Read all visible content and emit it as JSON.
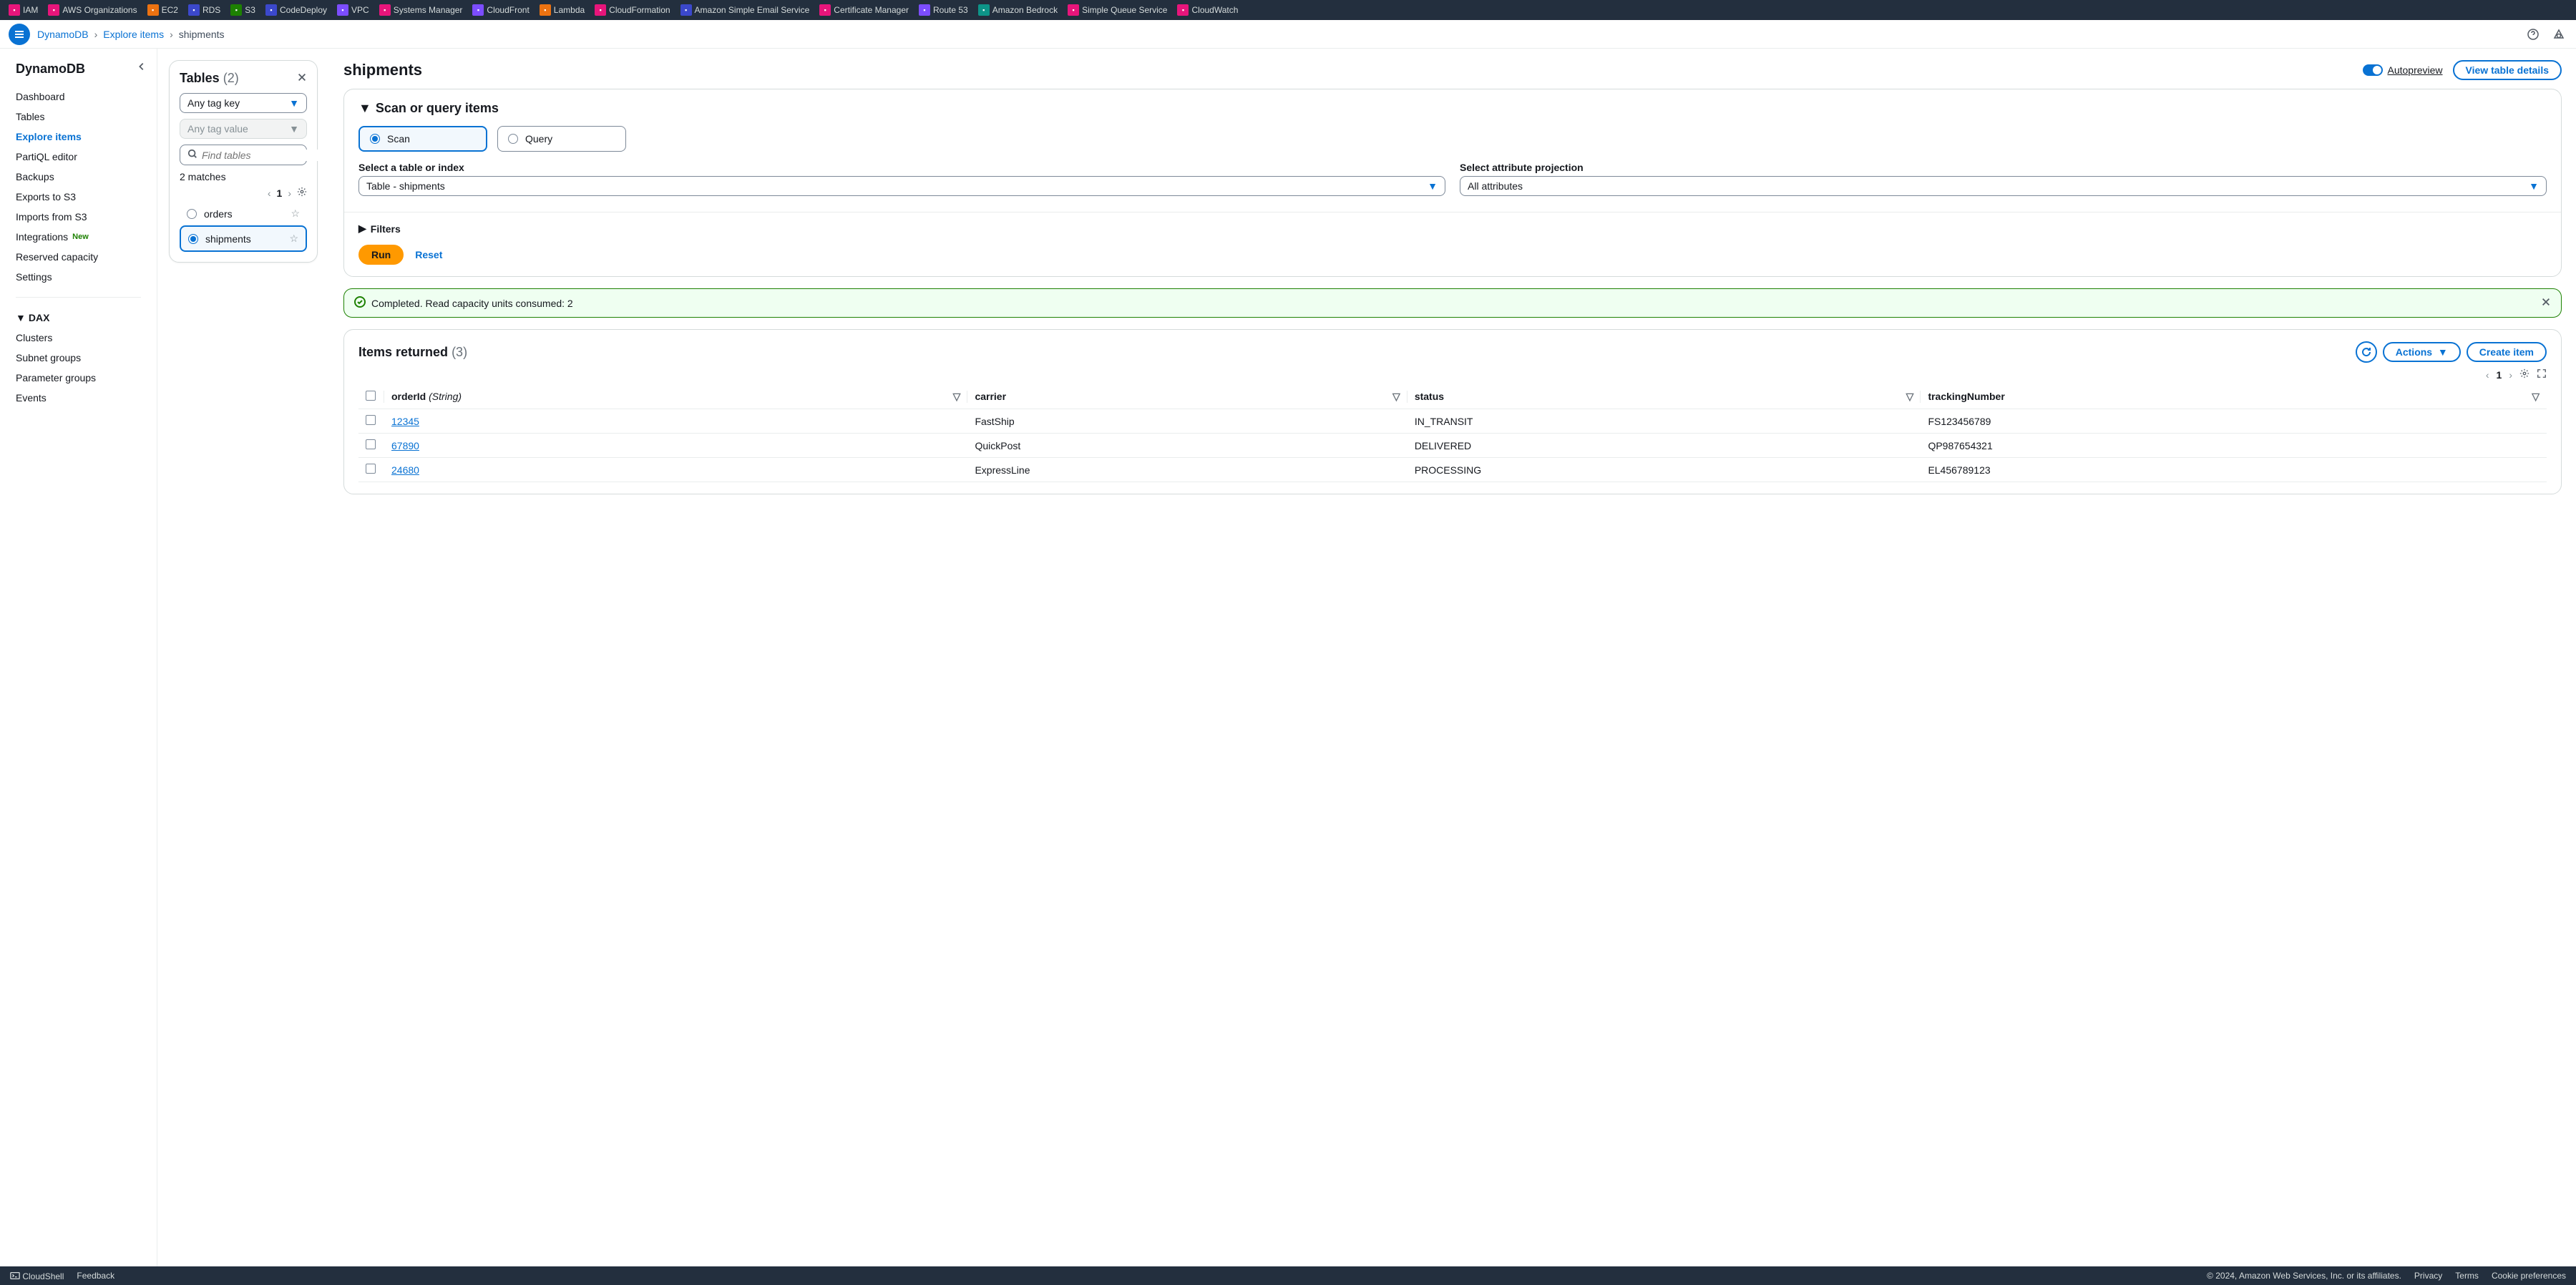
{
  "services": [
    {
      "label": "IAM",
      "bg": "#e7157b"
    },
    {
      "label": "AWS Organizations",
      "bg": "#e7157b"
    },
    {
      "label": "EC2",
      "bg": "#ec7211"
    },
    {
      "label": "RDS",
      "bg": "#3b48cc"
    },
    {
      "label": "S3",
      "bg": "#1d8102"
    },
    {
      "label": "CodeDeploy",
      "bg": "#3b48cc"
    },
    {
      "label": "VPC",
      "bg": "#7c4dff"
    },
    {
      "label": "Systems Manager",
      "bg": "#e7157b"
    },
    {
      "label": "CloudFront",
      "bg": "#7c4dff"
    },
    {
      "label": "Lambda",
      "bg": "#ec7211"
    },
    {
      "label": "CloudFormation",
      "bg": "#e7157b"
    },
    {
      "label": "Amazon Simple Email Service",
      "bg": "#3b48cc"
    },
    {
      "label": "Certificate Manager",
      "bg": "#e7157b"
    },
    {
      "label": "Route 53",
      "bg": "#7c4dff"
    },
    {
      "label": "Amazon Bedrock",
      "bg": "#0d9488"
    },
    {
      "label": "Simple Queue Service",
      "bg": "#e7157b"
    },
    {
      "label": "CloudWatch",
      "bg": "#e7157b"
    }
  ],
  "breadcrumb": {
    "root": "DynamoDB",
    "mid": "Explore items",
    "current": "shipments"
  },
  "sidebar": {
    "title": "DynamoDB",
    "items": [
      {
        "label": "Dashboard"
      },
      {
        "label": "Tables"
      },
      {
        "label": "Explore items",
        "active": true
      },
      {
        "label": "PartiQL editor"
      },
      {
        "label": "Backups"
      },
      {
        "label": "Exports to S3"
      },
      {
        "label": "Imports from S3"
      },
      {
        "label": "Integrations",
        "badge": "New"
      },
      {
        "label": "Reserved capacity"
      },
      {
        "label": "Settings"
      }
    ],
    "dax": {
      "title": "DAX",
      "items": [
        "Clusters",
        "Subnet groups",
        "Parameter groups",
        "Events"
      ]
    }
  },
  "tablesPanel": {
    "title": "Tables",
    "count": "(2)",
    "tagKey": "Any tag key",
    "tagValue": "Any tag value",
    "searchPlaceholder": "Find tables",
    "matches": "2 matches",
    "page": "1",
    "rows": [
      {
        "name": "orders",
        "selected": false
      },
      {
        "name": "shipments",
        "selected": true
      }
    ]
  },
  "main": {
    "title": "shipments",
    "autopreview": "Autopreview",
    "viewDetails": "View table details",
    "scanQuery": {
      "title": "Scan or query items",
      "scan": "Scan",
      "query": "Query",
      "tableLabel": "Select a table or index",
      "tableValue": "Table - shipments",
      "projLabel": "Select attribute projection",
      "projValue": "All attributes",
      "filters": "Filters",
      "run": "Run",
      "reset": "Reset"
    },
    "flash": "Completed. Read capacity units consumed: 2",
    "items": {
      "title": "Items returned",
      "count": "(3)",
      "actions": "Actions",
      "create": "Create item",
      "page": "1",
      "columns": [
        {
          "label": "orderId",
          "type": "(String)"
        },
        {
          "label": "carrier"
        },
        {
          "label": "status"
        },
        {
          "label": "trackingNumber"
        }
      ],
      "rows": [
        {
          "orderId": "12345",
          "carrier": "FastShip",
          "status": "IN_TRANSIT",
          "trackingNumber": "FS123456789"
        },
        {
          "orderId": "67890",
          "carrier": "QuickPost",
          "status": "DELIVERED",
          "trackingNumber": "QP987654321"
        },
        {
          "orderId": "24680",
          "carrier": "ExpressLine",
          "status": "PROCESSING",
          "trackingNumber": "EL456789123"
        }
      ]
    }
  },
  "footer": {
    "cloudshell": "CloudShell",
    "feedback": "Feedback",
    "copyright": "© 2024, Amazon Web Services, Inc. or its affiliates.",
    "privacy": "Privacy",
    "terms": "Terms",
    "cookies": "Cookie preferences"
  }
}
